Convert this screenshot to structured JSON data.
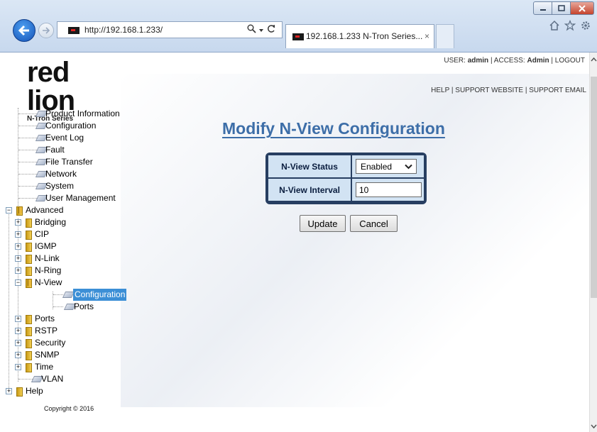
{
  "browser": {
    "url": "http://192.168.1.233/",
    "search_icon": "search-icon",
    "tab_title": "192.168.1.233 N-Tron Series...",
    "tab_close": "×"
  },
  "header": {
    "logo_text": "red lion",
    "logo_sub": "N-Tron Series",
    "user_label": "USER:",
    "user_value": "admin",
    "access_label": "ACCESS:",
    "access_value": "Admin",
    "logout": "LOGOUT",
    "help": "HELP",
    "support_website": "SUPPORT WEBSITE",
    "support_email": "SUPPORT EMAIL",
    "separator": "|"
  },
  "tree": {
    "items": [
      {
        "label": "Product Information"
      },
      {
        "label": "Configuration"
      },
      {
        "label": "Event Log"
      },
      {
        "label": "Fault"
      },
      {
        "label": "File Transfer"
      },
      {
        "label": "Network"
      },
      {
        "label": "System"
      },
      {
        "label": "User Management"
      },
      {
        "label": "Advanced"
      },
      {
        "label": "Bridging"
      },
      {
        "label": "CIP"
      },
      {
        "label": "IGMP"
      },
      {
        "label": "N-Link"
      },
      {
        "label": "N-Ring"
      },
      {
        "label": "N-View"
      },
      {
        "label": "Configuration"
      },
      {
        "label": "Ports"
      },
      {
        "label": "Ports"
      },
      {
        "label": "RSTP"
      },
      {
        "label": "Security"
      },
      {
        "label": "SNMP"
      },
      {
        "label": "Time"
      },
      {
        "label": "VLAN"
      },
      {
        "label": "Help"
      }
    ],
    "copyright": "Copyright © 2016"
  },
  "main": {
    "title": "Modify N-View Configuration",
    "status_label": "N-View Status",
    "status_value": "Enabled",
    "interval_label": "N-View Interval",
    "interval_value": "10",
    "update_label": "Update",
    "cancel_label": "Cancel"
  }
}
